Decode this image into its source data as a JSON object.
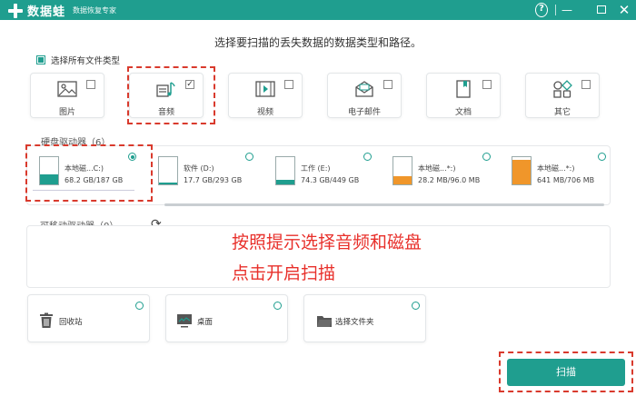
{
  "app": {
    "name": "数据蛙",
    "slogan": "数据恢复专家"
  },
  "window_controls": {
    "help": "?",
    "minimize": "—",
    "close": "✕"
  },
  "instruction": "选择要扫描的丢失数据的数据类型和路径。",
  "select_all_label": "选择所有文件类型",
  "file_types": [
    {
      "label": "图片",
      "icon": "image-icon",
      "checked": false
    },
    {
      "label": "音频",
      "icon": "audio-icon",
      "checked": true
    },
    {
      "label": "视频",
      "icon": "video-icon",
      "checked": false
    },
    {
      "label": "电子邮件",
      "icon": "email-icon",
      "checked": false
    },
    {
      "label": "文档",
      "icon": "document-icon",
      "checked": false
    },
    {
      "label": "其它",
      "icon": "other-icon",
      "checked": false
    }
  ],
  "checkbox_mark": "✓",
  "hard_drives": {
    "title": "硬盘驱动器（6）",
    "drives": [
      {
        "name": "本地磁...C:)",
        "size": "68.2 GB/187 GB",
        "used_fraction": 0.365,
        "fill_color": "#1f9e8f",
        "selected": true
      },
      {
        "name": "软件 (D:)",
        "size": "17.7 GB/293 GB",
        "used_fraction": 0.06,
        "fill_color": "#1f9e8f",
        "selected": false
      },
      {
        "name": "工作 (E:)",
        "size": "74.3 GB/449 GB",
        "used_fraction": 0.165,
        "fill_color": "#1f9e8f",
        "selected": false
      },
      {
        "name": "本地磁...*:)",
        "size": "28.2 MB/96.0 MB",
        "used_fraction": 0.29,
        "fill_color": "#f0962a",
        "selected": false
      },
      {
        "name": "本地磁...*:)",
        "size": "641 MB/706 MB",
        "used_fraction": 0.91,
        "fill_color": "#f0962a",
        "selected": false
      }
    ]
  },
  "removable_drives": {
    "title": "可移动驱动器（0）",
    "refresh_icon": "refresh-icon"
  },
  "locations": [
    {
      "label": "回收站",
      "icon": "recycle-bin-icon"
    },
    {
      "label": "桌面",
      "icon": "desktop-icon"
    },
    {
      "label": "选择文件夹",
      "icon": "folder-icon"
    }
  ],
  "annotation": {
    "line1": "按照提示选择音频和磁盘",
    "line2": "点击开启扫描"
  },
  "scan_button": "扫描",
  "colors": {
    "accent": "#1f9e8f",
    "warning": "#f0962a",
    "annotation": "#e8302b"
  }
}
